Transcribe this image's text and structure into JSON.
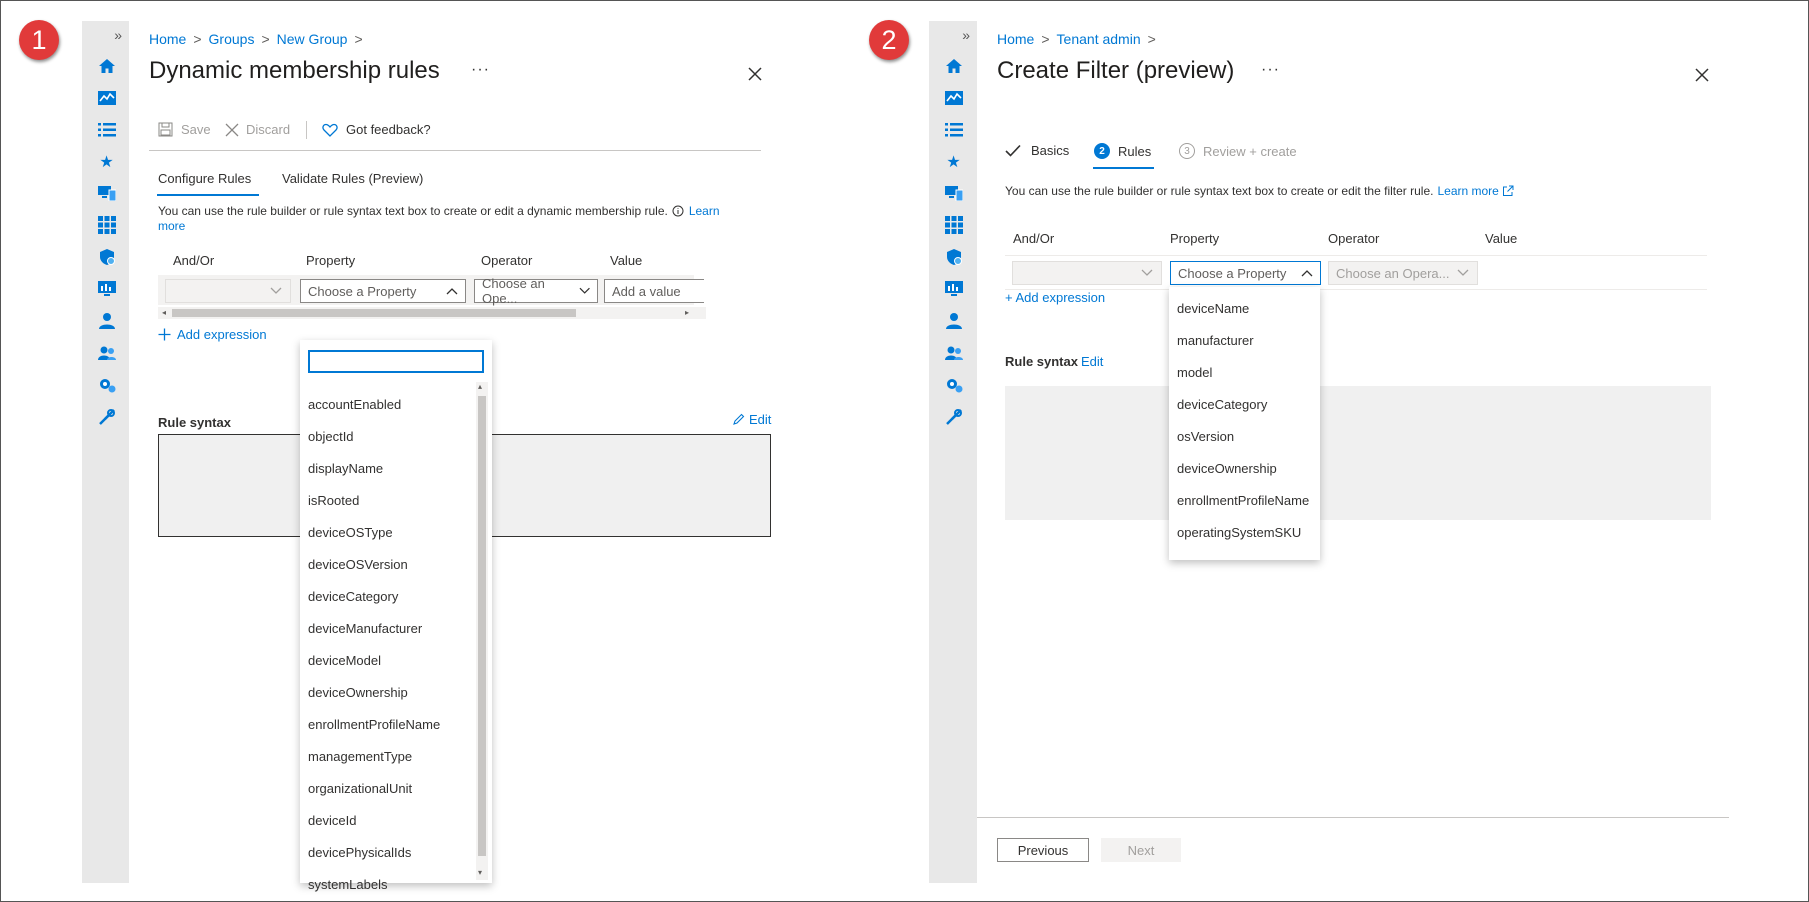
{
  "badges": [
    "1",
    "2"
  ],
  "left": {
    "breadcrumb": [
      "Home",
      "Groups",
      "New Group"
    ],
    "title": "Dynamic membership rules",
    "more": "···",
    "toolbar": {
      "save": "Save",
      "discard": "Discard",
      "feedback": "Got feedback?"
    },
    "tabs": [
      "Configure Rules",
      "Validate Rules (Preview)"
    ],
    "description": "You can use the rule builder or rule syntax text box to create or edit a dynamic membership rule.",
    "learn_more_1": "Learn",
    "learn_more_2": "more",
    "columns": [
      "And/Or",
      "Property",
      "Operator",
      "Value"
    ],
    "property_placeholder": "Choose a Property",
    "operator_placeholder": "Choose an Ope...",
    "value_placeholder": "Add a value",
    "add_expression": "Add expression",
    "rule_syntax": "Rule syntax",
    "edit": "Edit",
    "options": [
      "accountEnabled",
      "objectId",
      "displayName",
      "isRooted",
      "deviceOSType",
      "deviceOSVersion",
      "deviceCategory",
      "deviceManufacturer",
      "deviceModel",
      "deviceOwnership",
      "enrollmentProfileName",
      "managementType",
      "organizationalUnit",
      "deviceId",
      "devicePhysicalIds",
      "systemLabels"
    ]
  },
  "right": {
    "breadcrumb": [
      "Home",
      "Tenant admin"
    ],
    "title": "Create Filter (preview)",
    "more": "···",
    "steps": [
      {
        "num": "",
        "label": "Basics"
      },
      {
        "num": "2",
        "label": "Rules"
      },
      {
        "num": "3",
        "label": "Review + create"
      }
    ],
    "description": "You can use the rule builder or rule syntax text box to create or edit the filter rule.",
    "learn_more": "Learn more",
    "columns": [
      "And/Or",
      "Property",
      "Operator",
      "Value"
    ],
    "property_placeholder": "Choose a Property",
    "operator_placeholder": "Choose an Opera...",
    "add_expression": "+ Add expression",
    "rule_syntax": "Rule syntax",
    "edit": "Edit",
    "options": [
      "deviceName",
      "manufacturer",
      "model",
      "deviceCategory",
      "osVersion",
      "deviceOwnership",
      "enrollmentProfileName",
      "operatingSystemSKU"
    ],
    "previous": "Previous",
    "next": "Next"
  }
}
